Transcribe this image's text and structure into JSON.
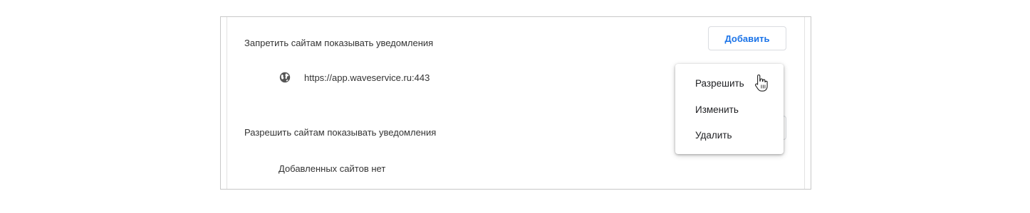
{
  "block_section": {
    "label": "Запретить сайтам показывать уведомления",
    "add_button_label": "Добавить",
    "sites": [
      {
        "url": "https://app.waveservice.ru:443",
        "icon": "globe-icon"
      }
    ]
  },
  "allow_section": {
    "label": "Разрешить сайтам показывать уведомления",
    "empty_text": "Добавленных сайтов нет"
  },
  "context_menu": {
    "items": [
      {
        "label": "Разрешить"
      },
      {
        "label": "Изменить"
      },
      {
        "label": "Удалить"
      }
    ]
  },
  "colors": {
    "accent": "#1a73e8",
    "text": "#333333",
    "border": "#dadce0"
  },
  "pointer": "hand-pointer-icon"
}
